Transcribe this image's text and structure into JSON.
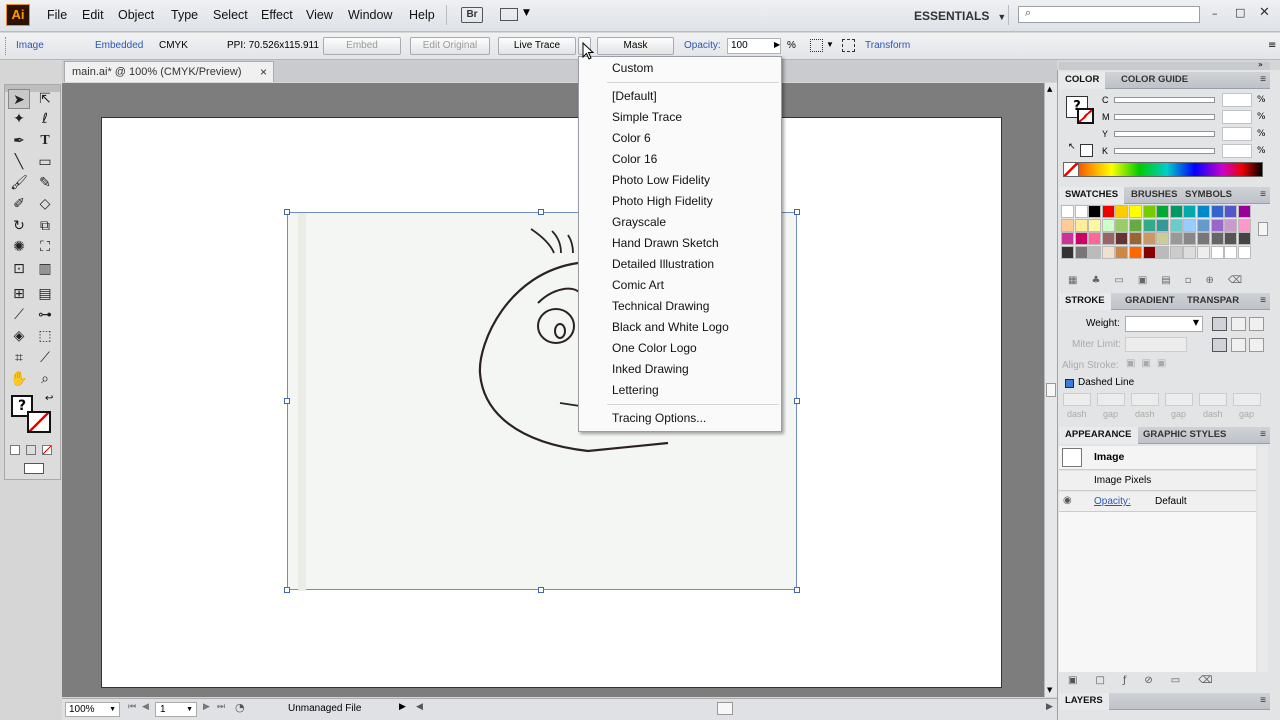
{
  "app": {
    "logo": "Ai"
  },
  "menu": [
    "File",
    "Edit",
    "Object",
    "Type",
    "Select",
    "Effect",
    "View",
    "Window",
    "Help"
  ],
  "bridge_label": "Br",
  "workspace": "ESSENTIALS",
  "control_bar": {
    "selection": "Image",
    "embedded": "Embedded",
    "mode": "CMYK",
    "ppi": "PPI: 70.526x115.911",
    "embed_btn": "Embed",
    "edit_original_btn": "Edit Original",
    "live_trace_btn": "Live Trace",
    "mask_btn": "Mask",
    "opacity_label": "Opacity:",
    "opacity_value": "100",
    "opacity_unit": "%",
    "transform": "Transform"
  },
  "doc_tab": {
    "title": "main.ai* @ 100% (CMYK/Preview)",
    "close": "×"
  },
  "trace_menu": {
    "items": [
      "Custom",
      "[Default]",
      "Simple Trace",
      "Color 6",
      "Color 16",
      "Photo Low Fidelity",
      "Photo High Fidelity",
      "Grayscale",
      "Hand Drawn Sketch",
      "Detailed Illustration",
      "Comic Art",
      "Technical Drawing",
      "Black and White Logo",
      "One Color Logo",
      "Inked Drawing",
      "Lettering",
      "Tracing Options..."
    ]
  },
  "status": {
    "zoom": "100%",
    "page": "1",
    "info": "Unmanaged File"
  },
  "color_panel": {
    "tabs": [
      "COLOR",
      "COLOR GUIDE"
    ],
    "channels": [
      "C",
      "M",
      "Y",
      "K"
    ],
    "unit": "%"
  },
  "swatches_panel": {
    "tabs": [
      "SWATCHES",
      "BRUSHES",
      "SYMBOLS"
    ]
  },
  "stroke_panel": {
    "tabs": [
      "STROKE",
      "GRADIENT",
      "TRANSPAR"
    ],
    "weight": "Weight:",
    "miter": "Miter Limit:",
    "align": "Align Stroke:",
    "dashed": "Dashed Line",
    "dash": "dash",
    "gap": "gap"
  },
  "appearance_panel": {
    "tabs": [
      "APPEARANCE",
      "GRAPHIC STYLES"
    ],
    "item": "Image",
    "pixels": "Image Pixels",
    "opacity_label": "Opacity:",
    "opacity_value": "Default"
  },
  "layers_panel": {
    "tab": "LAYERS"
  },
  "colors": {
    "accent": "#ff9a00",
    "link": "#2a55b8",
    "selection": "#4466aa"
  }
}
